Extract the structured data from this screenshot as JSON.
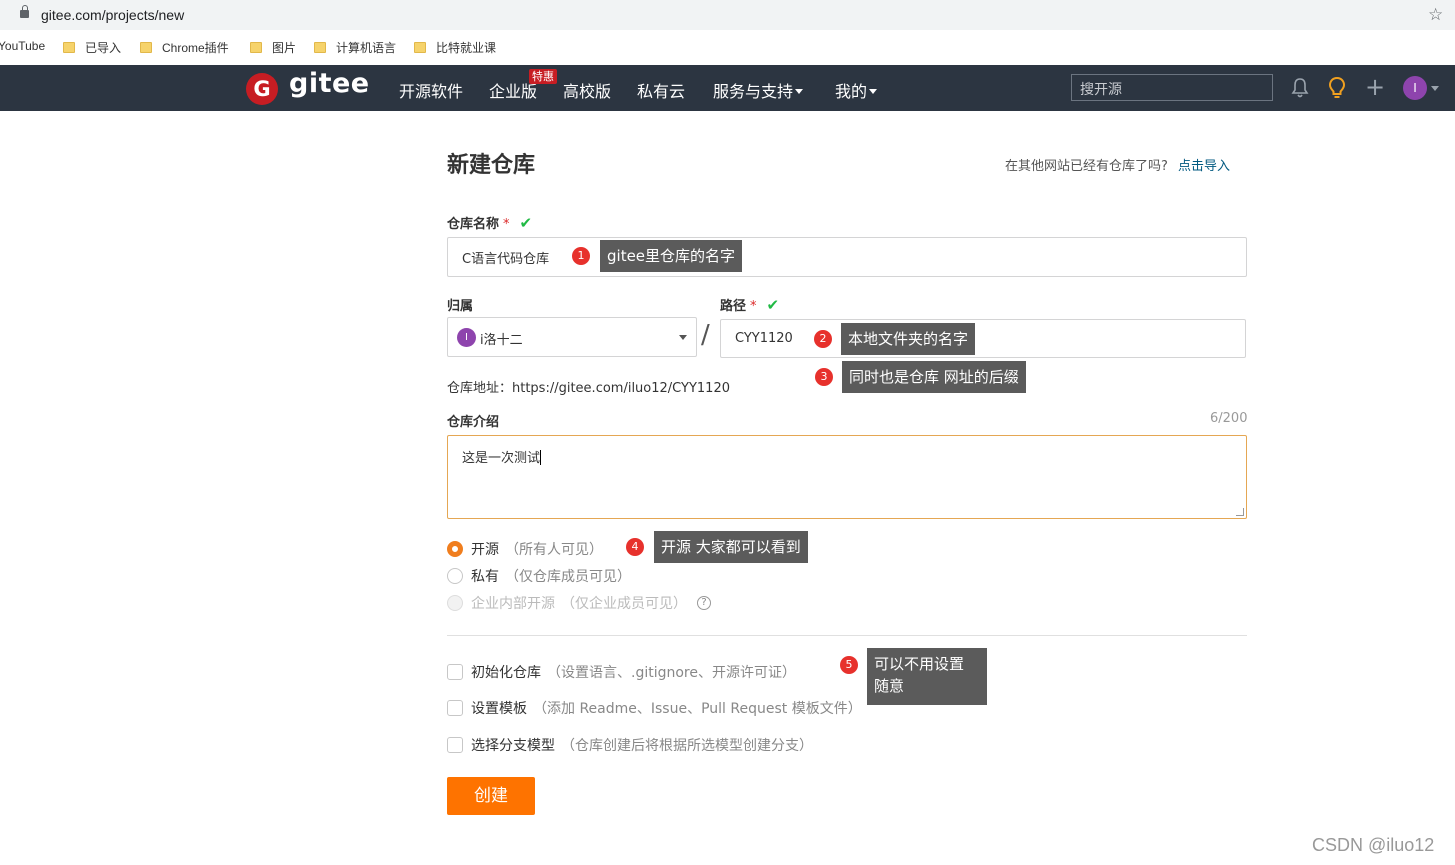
{
  "browser": {
    "url": "gitee.com/projects/new",
    "bookmarks": [
      "YouTube",
      "已导入",
      "Chrome插件",
      "图片",
      "计算机语言",
      "比特就业课"
    ]
  },
  "navbar": {
    "logo_letter": "G",
    "logo_text": "gitee",
    "items": [
      "开源软件",
      "企业版",
      "高校版",
      "私有云",
      "服务与支持",
      "我的"
    ],
    "enterprise_badge": "特惠",
    "search_placeholder": "搜开源",
    "avatar_letter": "I"
  },
  "page": {
    "title": "新建仓库",
    "import_question": "在其他网站已经有仓库了吗?",
    "import_link": "点击导入"
  },
  "form": {
    "repo_name_label": "仓库名称",
    "required_mark": "*",
    "check_mark": "✔",
    "repo_name_value": "C语言代码仓库",
    "owner_label": "归属",
    "owner_avatar_letter": "I",
    "owner_value": "i洛十二",
    "path_label": "路径",
    "path_value": "CYY1120",
    "repo_url_text": "仓库地址：https://gitee.com/iluo12/CYY1120",
    "intro_label": "仓库介绍",
    "intro_counter": "6/200",
    "intro_value": "这是一次测试",
    "visibility": [
      {
        "label": "开源",
        "hint": "（所有人可见）",
        "selected": true
      },
      {
        "label": "私有",
        "hint": "（仅仓库成员可见）",
        "selected": false
      },
      {
        "label": "企业内部开源",
        "hint": "（仅企业成员可见）",
        "selected": false,
        "disabled": true
      }
    ],
    "help_glyph": "?",
    "options": [
      {
        "label": "初始化仓库",
        "hint": "（设置语言、.gitignore、开源许可证）",
        "checked": false
      },
      {
        "label": "设置模板",
        "hint": "（添加 Readme、Issue、Pull Request 模板文件）",
        "checked": false
      },
      {
        "label": "选择分支模型",
        "hint": "（仓库创建后将根据所选模型创建分支）",
        "checked": false
      }
    ],
    "create_button": "创建"
  },
  "annotations": [
    {
      "num": "1",
      "text": "gitee里仓库的名字"
    },
    {
      "num": "2",
      "text": "本地文件夹的名字"
    },
    {
      "num": "3",
      "text": "同时也是仓库 网址的后缀"
    },
    {
      "num": "4",
      "text": "开源 大家都可以看到"
    },
    {
      "num": "5",
      "text_line1": "可以不用设置",
      "text_line2": "随意"
    }
  ],
  "watermark": "CSDN @iluo12",
  "colors": {
    "navbar_bg": "#2c3541",
    "brand_red": "#c71d23",
    "create_orange": "#fe7300",
    "radio_orange": "#f07e1e",
    "success_green": "#21ba45",
    "annotation_gray": "#5b5b5b",
    "annotation_red": "#e7312c"
  }
}
